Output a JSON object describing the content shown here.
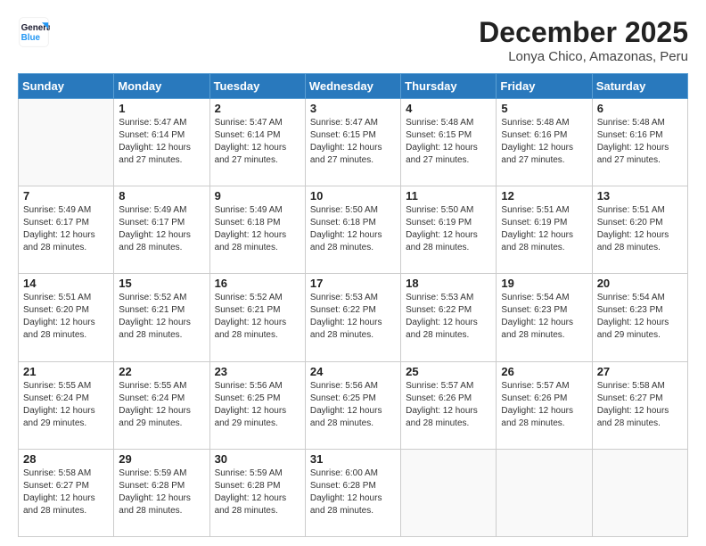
{
  "logo": {
    "line1": "General",
    "line2": "Blue"
  },
  "header": {
    "month": "December 2025",
    "location": "Lonya Chico, Amazonas, Peru"
  },
  "weekdays": [
    "Sunday",
    "Monday",
    "Tuesday",
    "Wednesday",
    "Thursday",
    "Friday",
    "Saturday"
  ],
  "weeks": [
    [
      {
        "day": "",
        "info": ""
      },
      {
        "day": "1",
        "info": "Sunrise: 5:47 AM\nSunset: 6:14 PM\nDaylight: 12 hours\nand 27 minutes."
      },
      {
        "day": "2",
        "info": "Sunrise: 5:47 AM\nSunset: 6:14 PM\nDaylight: 12 hours\nand 27 minutes."
      },
      {
        "day": "3",
        "info": "Sunrise: 5:47 AM\nSunset: 6:15 PM\nDaylight: 12 hours\nand 27 minutes."
      },
      {
        "day": "4",
        "info": "Sunrise: 5:48 AM\nSunset: 6:15 PM\nDaylight: 12 hours\nand 27 minutes."
      },
      {
        "day": "5",
        "info": "Sunrise: 5:48 AM\nSunset: 6:16 PM\nDaylight: 12 hours\nand 27 minutes."
      },
      {
        "day": "6",
        "info": "Sunrise: 5:48 AM\nSunset: 6:16 PM\nDaylight: 12 hours\nand 27 minutes."
      }
    ],
    [
      {
        "day": "7",
        "info": "Sunrise: 5:49 AM\nSunset: 6:17 PM\nDaylight: 12 hours\nand 28 minutes."
      },
      {
        "day": "8",
        "info": "Sunrise: 5:49 AM\nSunset: 6:17 PM\nDaylight: 12 hours\nand 28 minutes."
      },
      {
        "day": "9",
        "info": "Sunrise: 5:49 AM\nSunset: 6:18 PM\nDaylight: 12 hours\nand 28 minutes."
      },
      {
        "day": "10",
        "info": "Sunrise: 5:50 AM\nSunset: 6:18 PM\nDaylight: 12 hours\nand 28 minutes."
      },
      {
        "day": "11",
        "info": "Sunrise: 5:50 AM\nSunset: 6:19 PM\nDaylight: 12 hours\nand 28 minutes."
      },
      {
        "day": "12",
        "info": "Sunrise: 5:51 AM\nSunset: 6:19 PM\nDaylight: 12 hours\nand 28 minutes."
      },
      {
        "day": "13",
        "info": "Sunrise: 5:51 AM\nSunset: 6:20 PM\nDaylight: 12 hours\nand 28 minutes."
      }
    ],
    [
      {
        "day": "14",
        "info": "Sunrise: 5:51 AM\nSunset: 6:20 PM\nDaylight: 12 hours\nand 28 minutes."
      },
      {
        "day": "15",
        "info": "Sunrise: 5:52 AM\nSunset: 6:21 PM\nDaylight: 12 hours\nand 28 minutes."
      },
      {
        "day": "16",
        "info": "Sunrise: 5:52 AM\nSunset: 6:21 PM\nDaylight: 12 hours\nand 28 minutes."
      },
      {
        "day": "17",
        "info": "Sunrise: 5:53 AM\nSunset: 6:22 PM\nDaylight: 12 hours\nand 28 minutes."
      },
      {
        "day": "18",
        "info": "Sunrise: 5:53 AM\nSunset: 6:22 PM\nDaylight: 12 hours\nand 28 minutes."
      },
      {
        "day": "19",
        "info": "Sunrise: 5:54 AM\nSunset: 6:23 PM\nDaylight: 12 hours\nand 28 minutes."
      },
      {
        "day": "20",
        "info": "Sunrise: 5:54 AM\nSunset: 6:23 PM\nDaylight: 12 hours\nand 29 minutes."
      }
    ],
    [
      {
        "day": "21",
        "info": "Sunrise: 5:55 AM\nSunset: 6:24 PM\nDaylight: 12 hours\nand 29 minutes."
      },
      {
        "day": "22",
        "info": "Sunrise: 5:55 AM\nSunset: 6:24 PM\nDaylight: 12 hours\nand 29 minutes."
      },
      {
        "day": "23",
        "info": "Sunrise: 5:56 AM\nSunset: 6:25 PM\nDaylight: 12 hours\nand 29 minutes."
      },
      {
        "day": "24",
        "info": "Sunrise: 5:56 AM\nSunset: 6:25 PM\nDaylight: 12 hours\nand 28 minutes."
      },
      {
        "day": "25",
        "info": "Sunrise: 5:57 AM\nSunset: 6:26 PM\nDaylight: 12 hours\nand 28 minutes."
      },
      {
        "day": "26",
        "info": "Sunrise: 5:57 AM\nSunset: 6:26 PM\nDaylight: 12 hours\nand 28 minutes."
      },
      {
        "day": "27",
        "info": "Sunrise: 5:58 AM\nSunset: 6:27 PM\nDaylight: 12 hours\nand 28 minutes."
      }
    ],
    [
      {
        "day": "28",
        "info": "Sunrise: 5:58 AM\nSunset: 6:27 PM\nDaylight: 12 hours\nand 28 minutes."
      },
      {
        "day": "29",
        "info": "Sunrise: 5:59 AM\nSunset: 6:28 PM\nDaylight: 12 hours\nand 28 minutes."
      },
      {
        "day": "30",
        "info": "Sunrise: 5:59 AM\nSunset: 6:28 PM\nDaylight: 12 hours\nand 28 minutes."
      },
      {
        "day": "31",
        "info": "Sunrise: 6:00 AM\nSunset: 6:28 PM\nDaylight: 12 hours\nand 28 minutes."
      },
      {
        "day": "",
        "info": ""
      },
      {
        "day": "",
        "info": ""
      },
      {
        "day": "",
        "info": ""
      }
    ]
  ]
}
